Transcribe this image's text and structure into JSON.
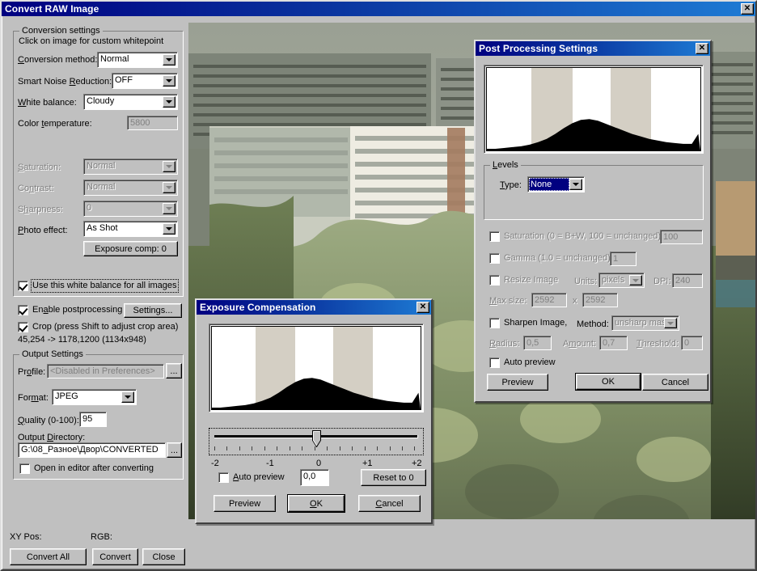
{
  "main_window": {
    "title": "Convert RAW Image",
    "close_label": "✕",
    "conversion_group": {
      "title": "Conversion settings",
      "hint": "Click on image for custom whitepoint",
      "fields": [
        {
          "label": "Conversion method:",
          "value": "Normal",
          "disabled": false
        },
        {
          "label": "Smart Noise Reduction:",
          "value": "OFF",
          "disabled": false
        },
        {
          "label": "White balance:",
          "value": "Cloudy",
          "disabled": false
        },
        {
          "label": "Color temperature:",
          "value": "5800",
          "disabled": true
        },
        {
          "label": "Saturation:",
          "value": "Normal",
          "disabled": true
        },
        {
          "label": "Contrast:",
          "value": "Normal",
          "disabled": true
        },
        {
          "label": "Sharpness:",
          "value": "0",
          "disabled": true
        },
        {
          "label": "Photo effect:",
          "value": "As Shot",
          "disabled": false
        }
      ],
      "exposure_comp_button": "Exposure comp: 0",
      "white_balance_all": {
        "label": "Use this white balance for all images",
        "checked": true
      }
    },
    "enable_postprocessing": {
      "label": "Enable postprocessing",
      "checked": true
    },
    "settings_button": "Settings...",
    "crop": {
      "label": "Crop (press Shift to adjust crop area)",
      "checked": true
    },
    "crop_coords": "45,254 -> 1178,1200 (1134x948)",
    "output_group": {
      "title": "Output Settings",
      "profile_label": "Profile:",
      "profile_value": "<Disabled in Preferences>",
      "profile_browse": "...",
      "format_label": "Format:",
      "format_value": "JPEG",
      "quality_label": "Quality (0-100):",
      "quality_value": "95",
      "output_dir_label": "Output Directory:",
      "output_dir_value": "G:\\08_Разное\\Двор\\CONVERTED",
      "output_dir_browse": "...",
      "open_in_editor": {
        "label": "Open in editor after converting",
        "checked": false
      }
    },
    "status": {
      "xy_pos_label": "XY Pos:",
      "xy_pos_value": "",
      "rgb_label": "RGB:",
      "rgb_value": ""
    },
    "buttons": {
      "convert_all": "Convert All",
      "convert": "Convert",
      "close": "Close"
    }
  },
  "post_processing": {
    "title": "Post Processing Settings",
    "close_label": "✕",
    "levels_group": {
      "title": "Levels",
      "type_label": "Type:",
      "type_value": "None"
    },
    "saturation": {
      "label": "Saturation (0 = B+W, 100 = unchanged):",
      "checked": false,
      "value": "100",
      "disabled": true
    },
    "gamma": {
      "label": "Gamma (1.0 = unchanged):",
      "checked": false,
      "value": "1",
      "disabled": true
    },
    "resize": {
      "label": "Resize Image",
      "checked": false,
      "units_label": "Units:",
      "units_value": "pixels",
      "dpi_label": "DPI:",
      "dpi_value": "240",
      "maxsize_label": "Max size:",
      "maxsize_w": "2592",
      "maxsize_x": "x",
      "maxsize_h": "2592"
    },
    "sharpen": {
      "label": "Sharpen Image,",
      "checked": false,
      "method_label": "Method:",
      "method_value": "unsharp mask",
      "radius_label": "Radius:",
      "radius_value": "0,5",
      "amount_label": "Amount:",
      "amount_value": "0,7",
      "threshold_label": "Threshold:",
      "threshold_value": "0"
    },
    "auto_preview": {
      "label": "Auto preview",
      "checked": false
    },
    "buttons": {
      "preview": "Preview",
      "ok": "OK",
      "cancel": "Cancel"
    }
  },
  "exposure_compensation": {
    "title": "Exposure Compensation",
    "close_label": "✕",
    "slider": {
      "ticks": [
        "-2",
        "-1",
        "0",
        "+1",
        "+2"
      ],
      "value": "0,0",
      "position_percent": 50
    },
    "auto_preview": {
      "label": "Auto preview",
      "checked": false
    },
    "reset_button": "Reset to 0",
    "buttons": {
      "preview": "Preview",
      "ok": "OK",
      "cancel": "Cancel"
    }
  },
  "chart_data": [
    {
      "type": "area",
      "name": "post-processing-histogram",
      "title": "",
      "xlabel": "",
      "ylabel": "",
      "x": [
        0,
        4,
        8,
        12,
        16,
        20,
        24,
        28,
        32,
        36,
        40,
        44,
        48,
        52,
        56,
        60,
        64,
        68,
        72,
        76,
        80,
        84,
        88,
        92,
        96,
        100
      ],
      "values": [
        2,
        2,
        3,
        4,
        5,
        7,
        10,
        14,
        20,
        27,
        33,
        37,
        38,
        36,
        32,
        28,
        24,
        20,
        17,
        14,
        12,
        10,
        9,
        8,
        8,
        20
      ],
      "ylim": [
        0,
        100
      ],
      "bands": [
        [
          21,
          40
        ],
        [
          58,
          77
        ]
      ],
      "band_color": "#d4cfc4",
      "fill_color": "#000000",
      "grid": false
    },
    {
      "type": "area",
      "name": "exposure-histogram",
      "title": "",
      "xlabel": "",
      "ylabel": "",
      "x": [
        0,
        4,
        8,
        12,
        16,
        20,
        24,
        28,
        32,
        36,
        40,
        44,
        48,
        52,
        56,
        60,
        64,
        68,
        72,
        76,
        80,
        84,
        88,
        92,
        96,
        100
      ],
      "values": [
        2,
        2,
        3,
        4,
        5,
        7,
        10,
        14,
        20,
        27,
        33,
        37,
        38,
        36,
        32,
        28,
        24,
        20,
        17,
        14,
        12,
        10,
        9,
        8,
        8,
        20
      ],
      "ylim": [
        0,
        100
      ],
      "bands": [
        [
          21,
          40
        ],
        [
          58,
          77
        ]
      ],
      "band_color": "#d4cfc4",
      "fill_color": "#000000",
      "grid": false
    }
  ]
}
